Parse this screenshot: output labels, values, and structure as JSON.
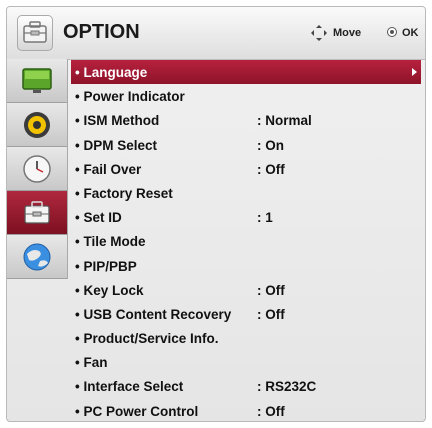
{
  "header": {
    "title": "OPTION",
    "move_label": "Move",
    "ok_label": "OK"
  },
  "categories": [
    {
      "icon": "tv-screen-icon",
      "selected": false
    },
    {
      "icon": "speaker-icon",
      "selected": false
    },
    {
      "icon": "clock-icon",
      "selected": false
    },
    {
      "icon": "toolbox-icon",
      "selected": true
    },
    {
      "icon": "globe-icon",
      "selected": false
    }
  ],
  "menu": {
    "items": [
      {
        "label": "• Language",
        "value": "",
        "selected": true
      },
      {
        "label": "• Power Indicator",
        "value": ""
      },
      {
        "label": "• ISM Method",
        "value": ": Normal"
      },
      {
        "label": "• DPM Select",
        "value": ": On"
      },
      {
        "label": "• Fail Over",
        "value": ": Off"
      },
      {
        "label": "• Factory Reset",
        "value": ""
      },
      {
        "label": "• Set ID",
        "value": ": 1"
      },
      {
        "label": "• Tile Mode",
        "value": ""
      },
      {
        "label": "• PIP/PBP",
        "value": ""
      },
      {
        "label": "• Key Lock",
        "value": ": Off"
      },
      {
        "label": "• USB Content Recovery",
        "value": ": Off"
      },
      {
        "label": "• Product/Service Info.",
        "value": ""
      },
      {
        "label": "• Fan",
        "value": ""
      },
      {
        "label": "• Interface Select",
        "value": ": RS232C"
      },
      {
        "label": "• PC Power Control",
        "value": ": Off"
      }
    ]
  },
  "colors": {
    "selected": "#a51b34",
    "panel": "#ebebeb",
    "text": "#111111"
  }
}
